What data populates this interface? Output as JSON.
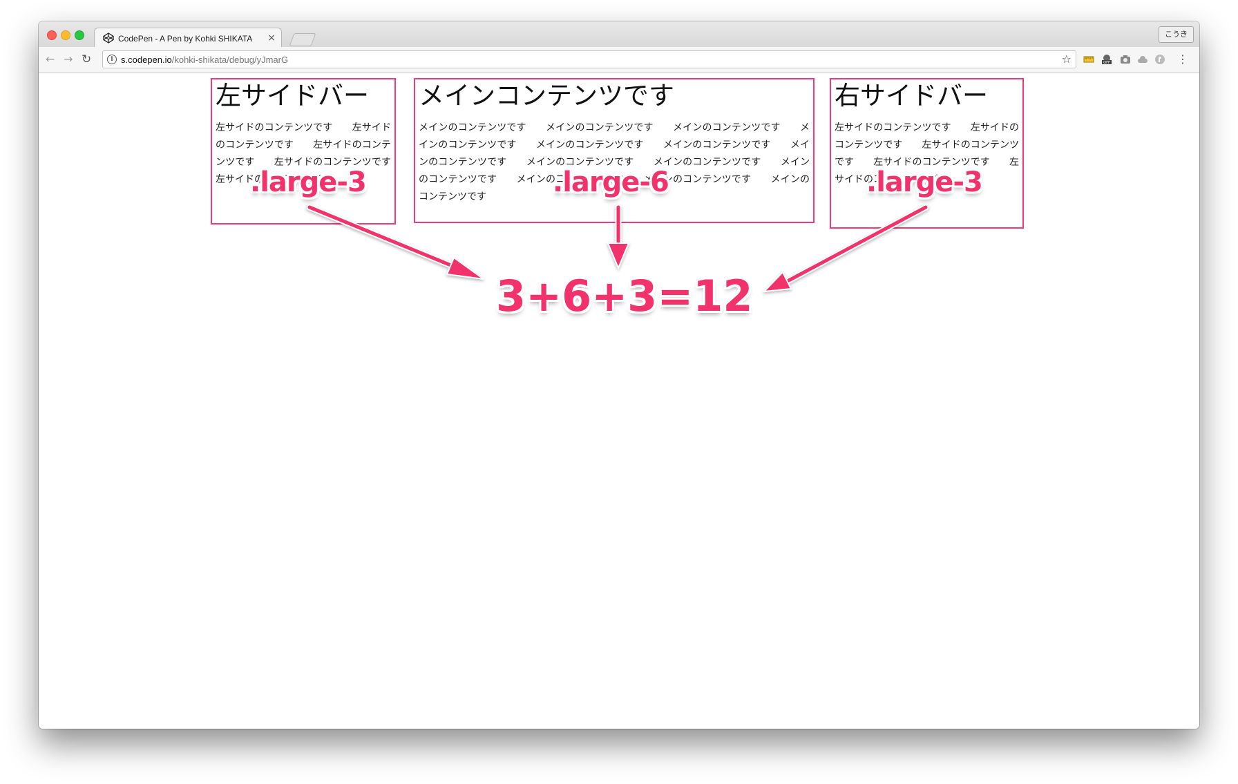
{
  "browser": {
    "tab_title": "CodePen - A Pen by Kohki SHIKATA",
    "tab_close": "×",
    "profile_label": "こうき",
    "url_host": "s.codepen.io",
    "url_path": "/kohki-shikata/debug/yJmarG",
    "info_glyph": "i",
    "bookmark_glyph": "☆",
    "menu_glyph": "⋮",
    "nav": {
      "back": "←",
      "forward": "→",
      "reload": "↻"
    },
    "icons": [
      "codepen-logo-icon",
      "ruler-extension-icon",
      "adblock-off-extension-icon",
      "camera-extension-icon",
      "cloud-extension-icon",
      "evernote-extension-icon"
    ]
  },
  "page": {
    "left": {
      "heading": "左サイドバー",
      "body": "左サイドのコンテンツです　　左サイドのコンテンツです　　左サイドのコンテンツです　　左サイドのコンテンツです　　左サイドのコンテンツです"
    },
    "main": {
      "heading": "メインコンテンツです",
      "body": "メインのコンテンツです　　メインのコンテンツです　　メインのコンテンツです　　メインのコンテンツです　　メインのコンテンツです　　メインのコンテンツです　　メインのコンテンツです　　メインのコンテンツです　　メインのコンテンツです　　メインのコンテンツです　　メインのコンテンツです　　メインのコンテンツです　　メインのコンテンツです"
    },
    "right": {
      "heading": "右サイドバー",
      "body": "左サイドのコンテンツです　　左サイドのコンテンツです　　左サイドのコンテンツです　　左サイドのコンテンツです　　左サイドのコンテンツです"
    }
  },
  "annotations": {
    "left_label": ".large-3",
    "main_label": ".large-6",
    "right_label": ".large-3",
    "equation": "3+6+3=12",
    "color": "#f2336b"
  },
  "colors": {
    "column_border": "#f23a74"
  }
}
